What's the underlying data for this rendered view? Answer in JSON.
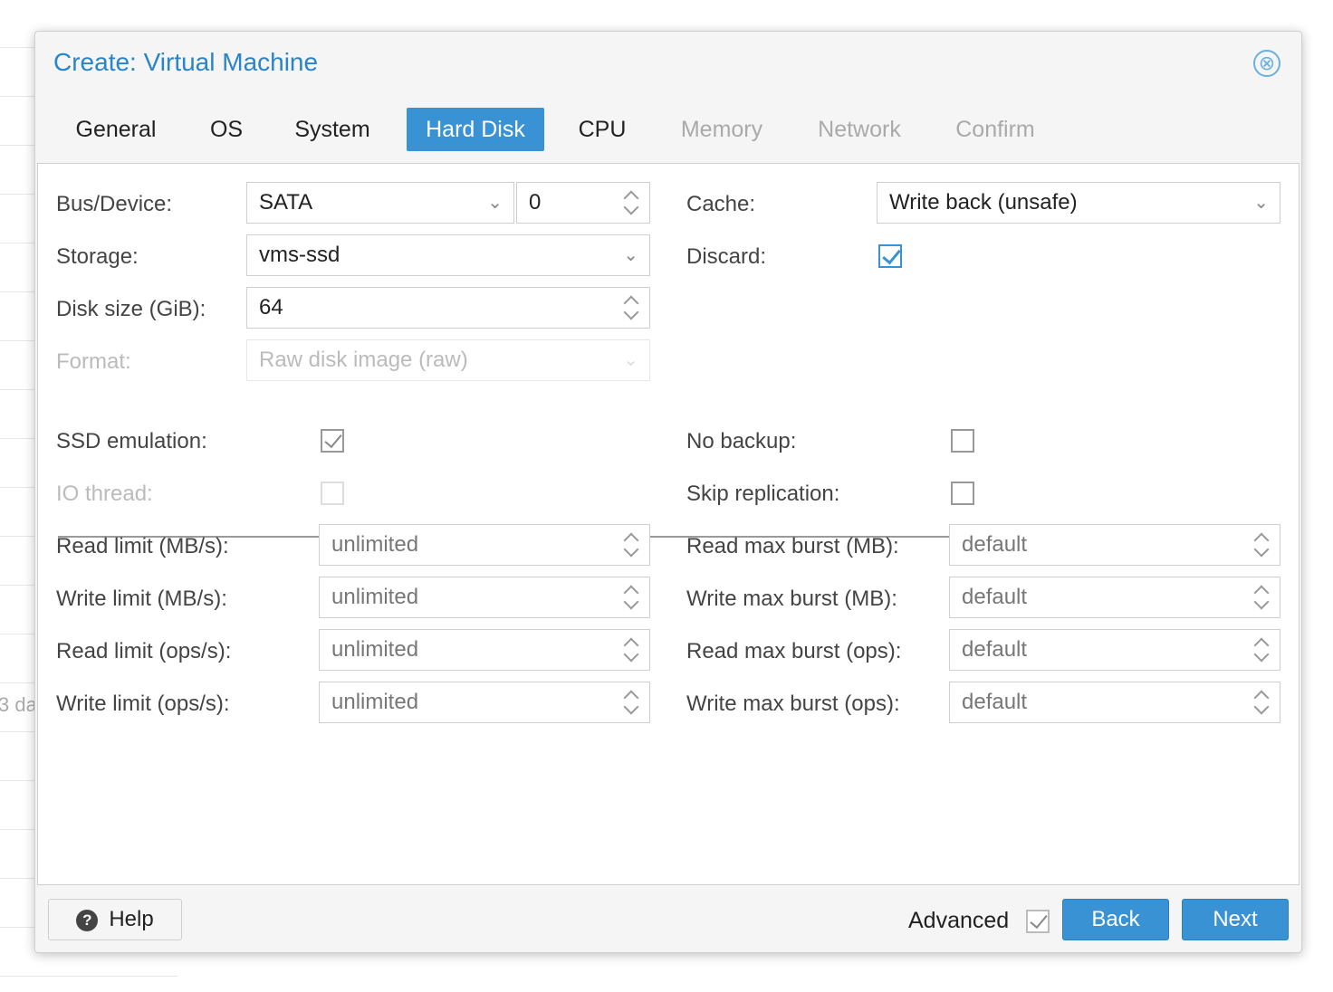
{
  "dialog": {
    "title": "Create: Virtual Machine",
    "close_icon": "⊗"
  },
  "tabs": [
    {
      "label": "General",
      "state": "normal"
    },
    {
      "label": "OS",
      "state": "normal"
    },
    {
      "label": "System",
      "state": "normal"
    },
    {
      "label": "Hard Disk",
      "state": "active"
    },
    {
      "label": "CPU",
      "state": "normal"
    },
    {
      "label": "Memory",
      "state": "disabled"
    },
    {
      "label": "Network",
      "state": "disabled"
    },
    {
      "label": "Confirm",
      "state": "disabled"
    }
  ],
  "disk": {
    "bus_label": "Bus/Device:",
    "bus_value": "SATA",
    "device_value": "0",
    "storage_label": "Storage:",
    "storage_value": "vms-ssd",
    "size_label": "Disk size (GiB):",
    "size_value": "64",
    "format_label": "Format:",
    "format_value": "Raw disk image (raw)",
    "cache_label": "Cache:",
    "cache_value": "Write back (unsafe)",
    "discard_label": "Discard:",
    "discard_checked": true
  },
  "advanced": {
    "ssd_label": "SSD emulation:",
    "ssd_checked": true,
    "iothread_label": "IO thread:",
    "iothread_checked": false,
    "nobackup_label": "No backup:",
    "nobackup_checked": false,
    "skiprep_label": "Skip replication:",
    "skiprep_checked": false,
    "limits": [
      {
        "label": "Read limit (MB/s):",
        "value": "unlimited"
      },
      {
        "label": "Write limit (MB/s):",
        "value": "unlimited"
      },
      {
        "label": "Read limit (ops/s):",
        "value": "unlimited"
      },
      {
        "label": "Write limit (ops/s):",
        "value": "unlimited"
      }
    ],
    "bursts": [
      {
        "label": "Read max burst (MB):",
        "value": "default"
      },
      {
        "label": "Write max burst (MB):",
        "value": "default"
      },
      {
        "label": "Read max burst (ops):",
        "value": "default"
      },
      {
        "label": "Write max burst (ops):",
        "value": "default"
      }
    ]
  },
  "footer": {
    "help_label": "Help",
    "help_icon": "?",
    "advanced_label": "Advanced",
    "advanced_checked": true,
    "back_label": "Back",
    "next_label": "Next"
  },
  "background": {
    "partial_text": "3 da"
  },
  "colors": {
    "accent": "#3892d3",
    "title": "#2a84c8"
  }
}
